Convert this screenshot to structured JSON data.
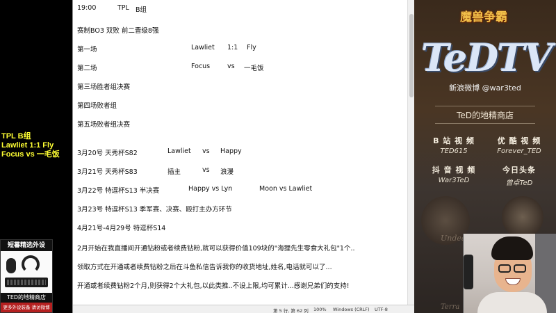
{
  "overlay": {
    "title": "TPL B组",
    "line1": "Lawliet 1:1 Fly",
    "line2": "Focus vs 一毛饭"
  },
  "shop_ad": {
    "title": "短暮精选外设",
    "name": "TED的地精商店",
    "sub": "更多外设装备 请访微博"
  },
  "doc": {
    "lines": [
      {
        "cells": [
          "19:00",
          "TPL",
          "B组"
        ]
      },
      {
        "cells": [
          "赛制BO3  双败  前二晋级8强"
        ]
      },
      {
        "cells": [
          "第一场",
          "Lawliet",
          "1:1",
          "Fly"
        ]
      },
      {
        "cells": [
          "第二场",
          "Focus",
          "vs",
          "一毛饭"
        ]
      },
      {
        "cells": [
          "第三场胜者组决赛"
        ]
      },
      {
        "cells": [
          "第四场败者组"
        ]
      },
      {
        "cells": [
          "第五场败者组决赛"
        ]
      },
      {
        "cells": [
          "3月20号  天秀杯S82",
          "Lawliet",
          "vs",
          "Happy"
        ]
      },
      {
        "cells": [
          "3月21号  天秀杯S83",
          "插主",
          "vs",
          "浪漫"
        ]
      },
      {
        "cells": [
          "3月22号  特逗杯S13  半决赛",
          "Happy  vs  Lyn",
          "Moon  vs  Lawliet"
        ]
      },
      {
        "cells": [
          "3月23号  特逗杯S13  季军赛、决赛、殴打主办方环节"
        ]
      },
      {
        "cells": [
          "4月21号-4月29号  特逗杯S14"
        ]
      },
      {
        "cells": [
          "2月开始在我直播间开通钻粉或者续费钻粉,就可以获得价值109块的\"海狸先生零食大礼包\"1个.."
        ]
      },
      {
        "cells": [
          "领取方式在开通或者续费钻粉之后在斗鱼私信告诉我你的收货地址,姓名,电话就可以了..."
        ]
      },
      {
        "cells": [
          "开通或者续费钻粉2个月,则获得2个大礼包,以此类推..不设上限,均可累计...感谢兄弟们的支持!"
        ]
      }
    ]
  },
  "statusbar": {
    "position": "第 5 行, 第 62 列",
    "zoom": "100%",
    "line_ending": "Windows (CRLF)",
    "encoding": "UTF-8"
  },
  "right_panel": {
    "logo_top": "魔兽争霸",
    "brand": "TeDTV",
    "weibo": "新浪微博 @war3ted",
    "shop": "TeD的地精商店",
    "socials": [
      {
        "title": "B 站 视 频",
        "id": "TED615"
      },
      {
        "title": "优 酷 视 频",
        "id": "Forever_TED"
      },
      {
        "title": "抖 音 视 频",
        "id": "War3TeD"
      },
      {
        "title": "今日头条",
        "id": "曾卓TeD"
      }
    ],
    "emblem_word_top": "Undea",
    "emblem_word_bottom": "Terra"
  }
}
